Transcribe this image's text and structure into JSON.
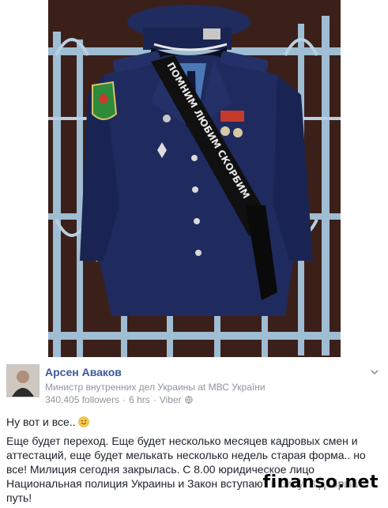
{
  "photo": {
    "ribbon_text": "ПОМНИМ ЛЮБИМ СКОРБИМ"
  },
  "post": {
    "author": "Арсен Аваков",
    "role_prefix": "Министр внутренних дел Украины at ",
    "page_name": "МВС України",
    "followers": "340,405 followers",
    "time": "6 hrs",
    "source": "Viber",
    "line1": "Ну вот и все..",
    "body": "Еще будет переход. Еще будет несколько месяцев кадровых смен и аттестаций, еще будет мелькать несколько недель старая форма.. но все! Милиция сегодня закрылась. С 8.00 юридическое лицо Национальная полиция Украины и Закон вступают в силу. В добрый путь!"
  },
  "watermark": {
    "brand": "finanso.net"
  },
  "colors": {
    "author": "#3b5998",
    "meta": "#90949c",
    "uniform": "#1e2a5c",
    "rail": "#a9c4d8"
  }
}
